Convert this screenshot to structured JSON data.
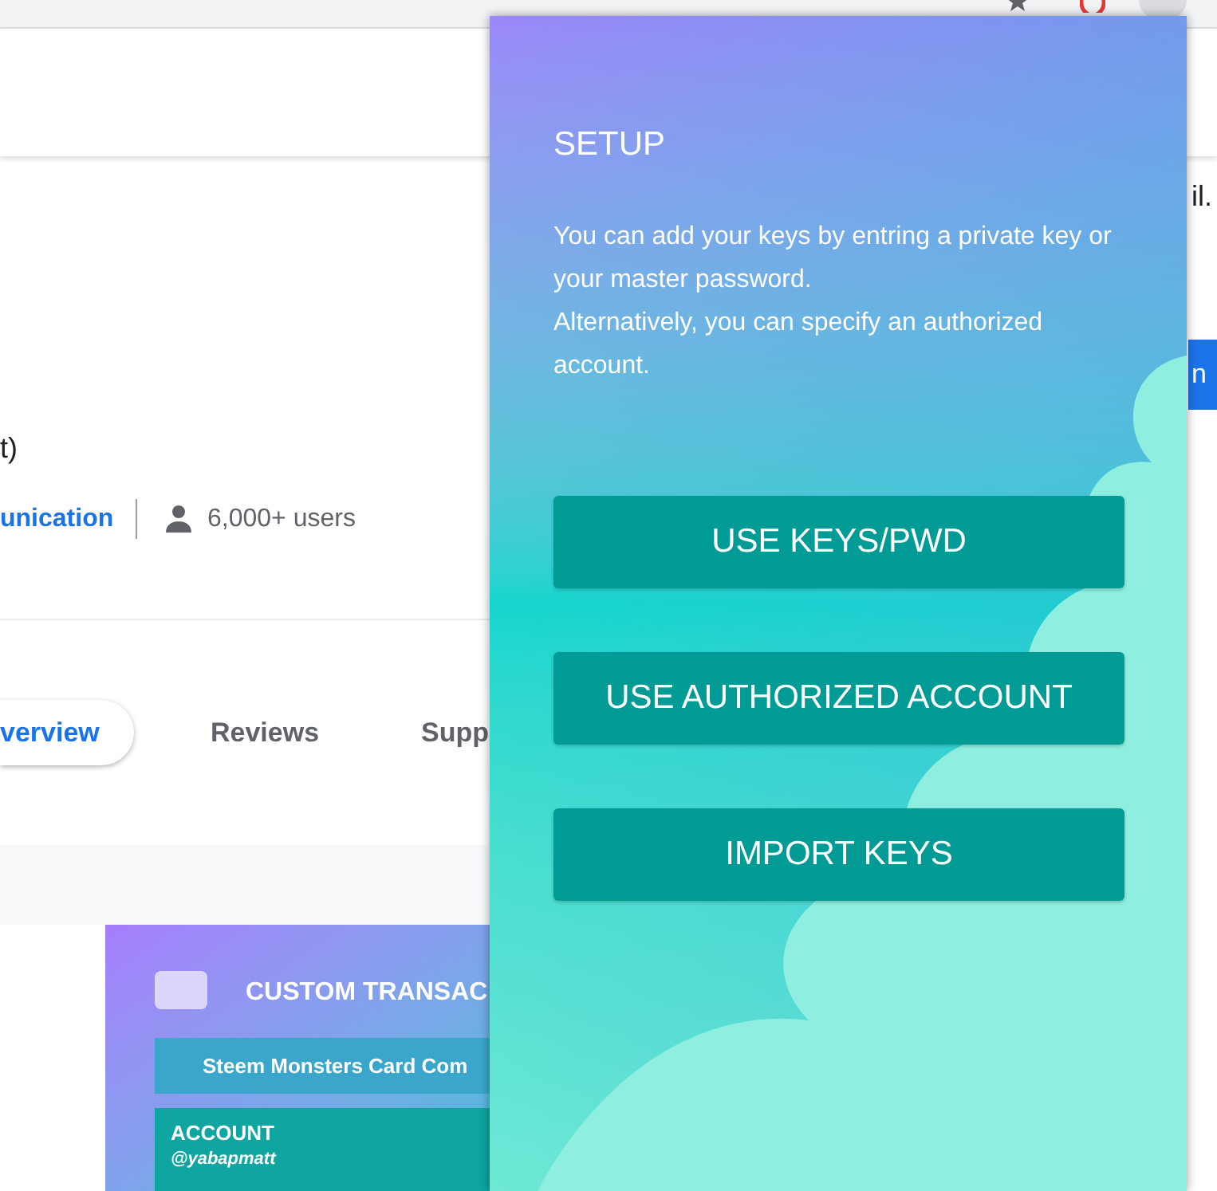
{
  "store_page": {
    "header_fragment": "il.",
    "title_fragment": "t)",
    "category_link": "unication",
    "users": "6,000+ users",
    "tabs": [
      {
        "label": "verview",
        "selected": true
      },
      {
        "label": "Reviews",
        "selected": false
      },
      {
        "label": "Supp",
        "selected": false
      }
    ],
    "side_button": "n",
    "screenshot": {
      "title": "CUSTOM TRANSAC",
      "operation": "Steem Monsters Card Com",
      "account_label": "ACCOUNT",
      "account_value": "@yabapmatt"
    }
  },
  "popup": {
    "title": "SETUP",
    "paragraphs": [
      "You can add your keys by entring a private key or your master password.",
      "Alternatively, you can specify an authorized account."
    ],
    "buttons": [
      "USE KEYS/PWD",
      "USE AUTHORIZED ACCOUNT",
      "IMPORT KEYS"
    ]
  }
}
